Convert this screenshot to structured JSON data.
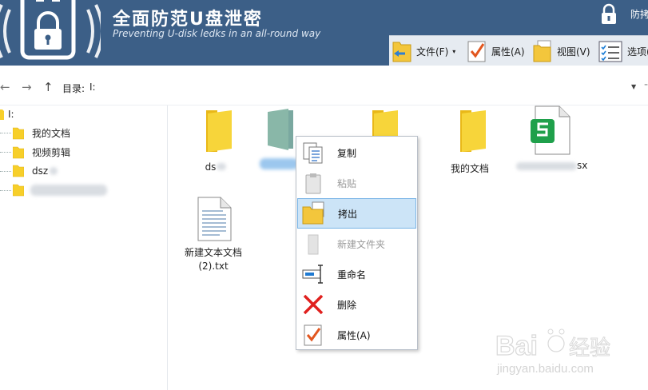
{
  "header": {
    "title": "全面防范U盘泄密",
    "subtitle": "Preventing U-disk ledks in an all-round way",
    "protect_label": "防拷"
  },
  "toolbar": {
    "items": [
      {
        "label": "文件(F)",
        "arrow": "▾"
      },
      {
        "label": "属性(A)"
      },
      {
        "label": "视图(V)"
      },
      {
        "label": "选项("
      }
    ]
  },
  "addressbar": {
    "back": "←",
    "forward": "→",
    "up": "↑",
    "label": "目录:",
    "path": "I:",
    "dropdown": "▼",
    "dash": "-"
  },
  "tree": {
    "root": "I:",
    "items": [
      "我的文档",
      "视频剪辑",
      "dsz"
    ]
  },
  "files": [
    {
      "name": "ds",
      "icon": "folder-icon"
    },
    {
      "name": "",
      "icon": "folder-green-icon"
    },
    {
      "name": "",
      "icon": "folder-icon"
    },
    {
      "name": "我的文档",
      "icon": "folder-icon"
    },
    {
      "name": "sx",
      "icon": "spreadsheet-icon"
    },
    {
      "name": "新建文本文档\n(2).txt",
      "icon": "text-file-icon"
    }
  ],
  "context_menu": {
    "items": [
      {
        "label": "复制",
        "enabled": true
      },
      {
        "label": "粘贴",
        "enabled": false
      },
      {
        "label": "拷出",
        "enabled": true,
        "highlighted": true
      },
      {
        "label": "新建文件夹",
        "enabled": false
      },
      {
        "label": "重命名",
        "enabled": true
      },
      {
        "label": "删除",
        "enabled": true
      },
      {
        "label": "属性(A)",
        "enabled": true
      }
    ]
  },
  "watermark": {
    "brand": "Bai",
    "brand_cn": "经验",
    "url": "jingyan.baidu.com"
  },
  "colors": {
    "header": "#3c5f87",
    "folder": "#f7cf2a",
    "highlight": "#cce4f7",
    "delete": "#e0201e",
    "sheet_green": "#1fa04b"
  }
}
